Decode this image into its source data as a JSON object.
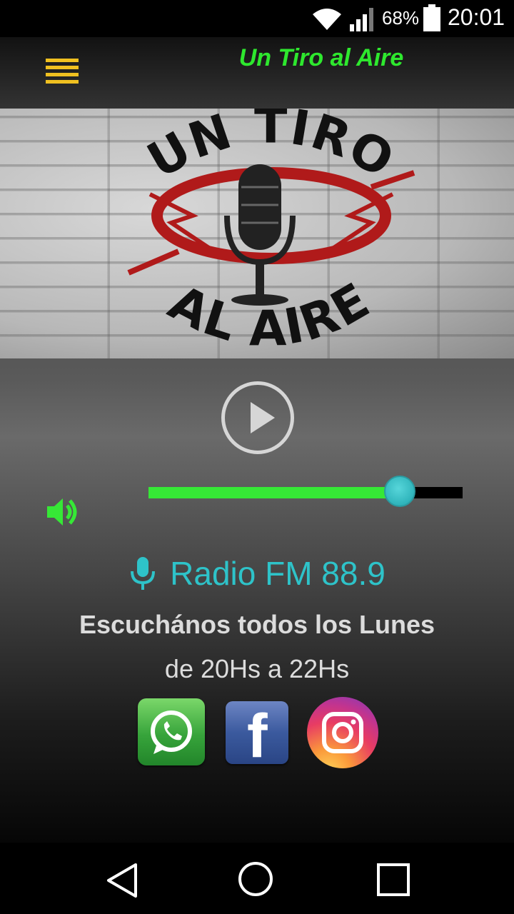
{
  "status_bar": {
    "battery_percent": "68%",
    "time": "20:01"
  },
  "toolbar": {
    "title": "Un Tiro al Aire",
    "menu_icon": "hamburger-menu-icon"
  },
  "banner": {
    "logo_top_text": "UN TIRO",
    "logo_bottom_text": "AL AIRE"
  },
  "player": {
    "play_icon": "play-icon",
    "volume_icon": "speaker-volume-icon",
    "volume_level": 0.8
  },
  "station": {
    "icon": "microphone-icon",
    "name": "Radio FM 88.9",
    "schedule_line1": "Escuchános todos los Lunes",
    "schedule_line2": "de 20Hs a 22Hs"
  },
  "social": [
    {
      "name": "whatsapp",
      "icon": "whatsapp-icon"
    },
    {
      "name": "facebook",
      "icon": "facebook-icon",
      "letter": "f"
    },
    {
      "name": "instagram",
      "icon": "instagram-icon"
    }
  ],
  "colors": {
    "title_green": "#2ee82e",
    "menu_yellow": "#f0c020",
    "station_cyan": "#2ec3c9",
    "slider_green": "#36e836",
    "thumb_cyan": "#2fb4bb"
  }
}
